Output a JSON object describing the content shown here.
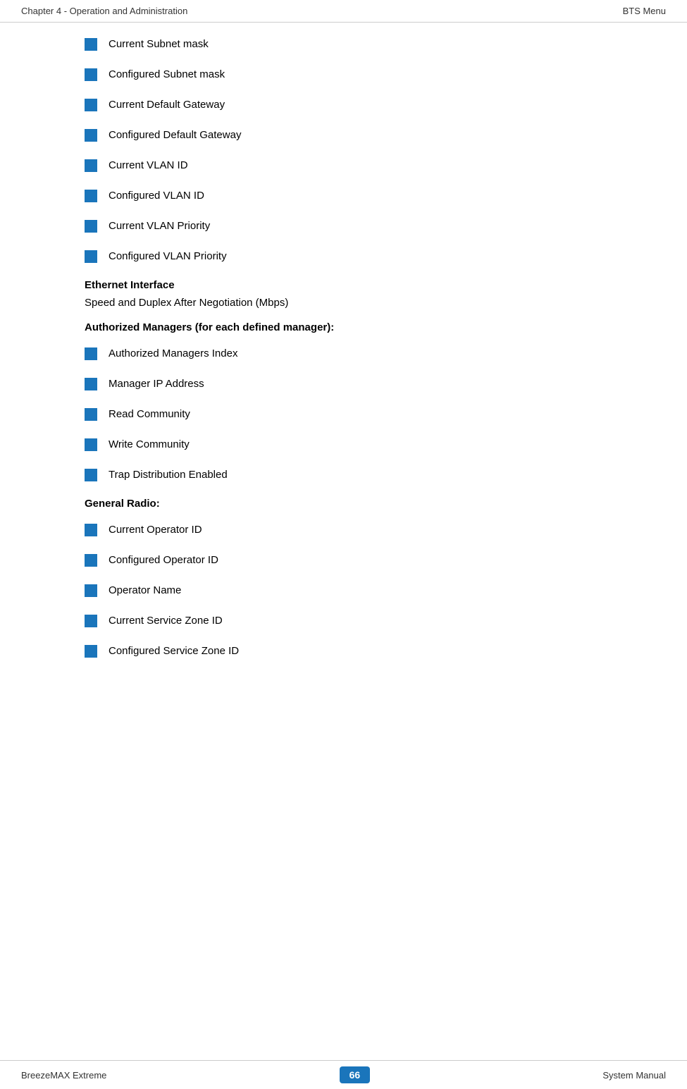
{
  "header": {
    "left": "Chapter 4 - Operation and Administration",
    "right": "BTS Menu"
  },
  "footer": {
    "left": "BreezeMAX Extreme",
    "page": "66",
    "right": "System Manual"
  },
  "bullet_items_top": [
    {
      "id": "current-subnet-mask",
      "text": "Current Subnet mask"
    },
    {
      "id": "configured-subnet-mask",
      "text": "Configured Subnet mask"
    },
    {
      "id": "current-default-gateway",
      "text": "Current Default Gateway"
    },
    {
      "id": "configured-default-gateway",
      "text": "Configured Default Gateway"
    },
    {
      "id": "current-vlan-id",
      "text": "Current VLAN ID"
    },
    {
      "id": "configured-vlan-id",
      "text": "Configured VLAN ID"
    },
    {
      "id": "current-vlan-priority",
      "text": "Current VLAN Priority"
    },
    {
      "id": "configured-vlan-priority",
      "text": "Configured VLAN Priority"
    }
  ],
  "ethernet_section": {
    "heading": "Ethernet Interface",
    "subtext": "Speed and Duplex After Negotiation (Mbps)"
  },
  "authorized_section": {
    "heading_bold": "Authorized Managers",
    "heading_normal": " (for each defined manager):"
  },
  "bullet_items_authorized": [
    {
      "id": "authorized-managers-index",
      "text": "Authorized Managers Index"
    },
    {
      "id": "manager-ip-address",
      "text": "Manager IP Address"
    },
    {
      "id": "read-community",
      "text": "Read Community"
    },
    {
      "id": "write-community",
      "text": "Write Community"
    },
    {
      "id": "trap-distribution-enabled",
      "text": "Trap Distribution Enabled"
    }
  ],
  "general_radio_section": {
    "heading_bold": "General Radio",
    "heading_normal": ":"
  },
  "bullet_items_radio": [
    {
      "id": "current-operator-id",
      "text": "Current Operator ID"
    },
    {
      "id": "configured-operator-id",
      "text": "Configured Operator ID"
    },
    {
      "id": "operator-name",
      "text": "Operator Name"
    },
    {
      "id": "current-service-zone-id",
      "text": "Current Service Zone ID"
    },
    {
      "id": "configured-service-zone-id",
      "text": "Configured Service Zone ID"
    }
  ]
}
